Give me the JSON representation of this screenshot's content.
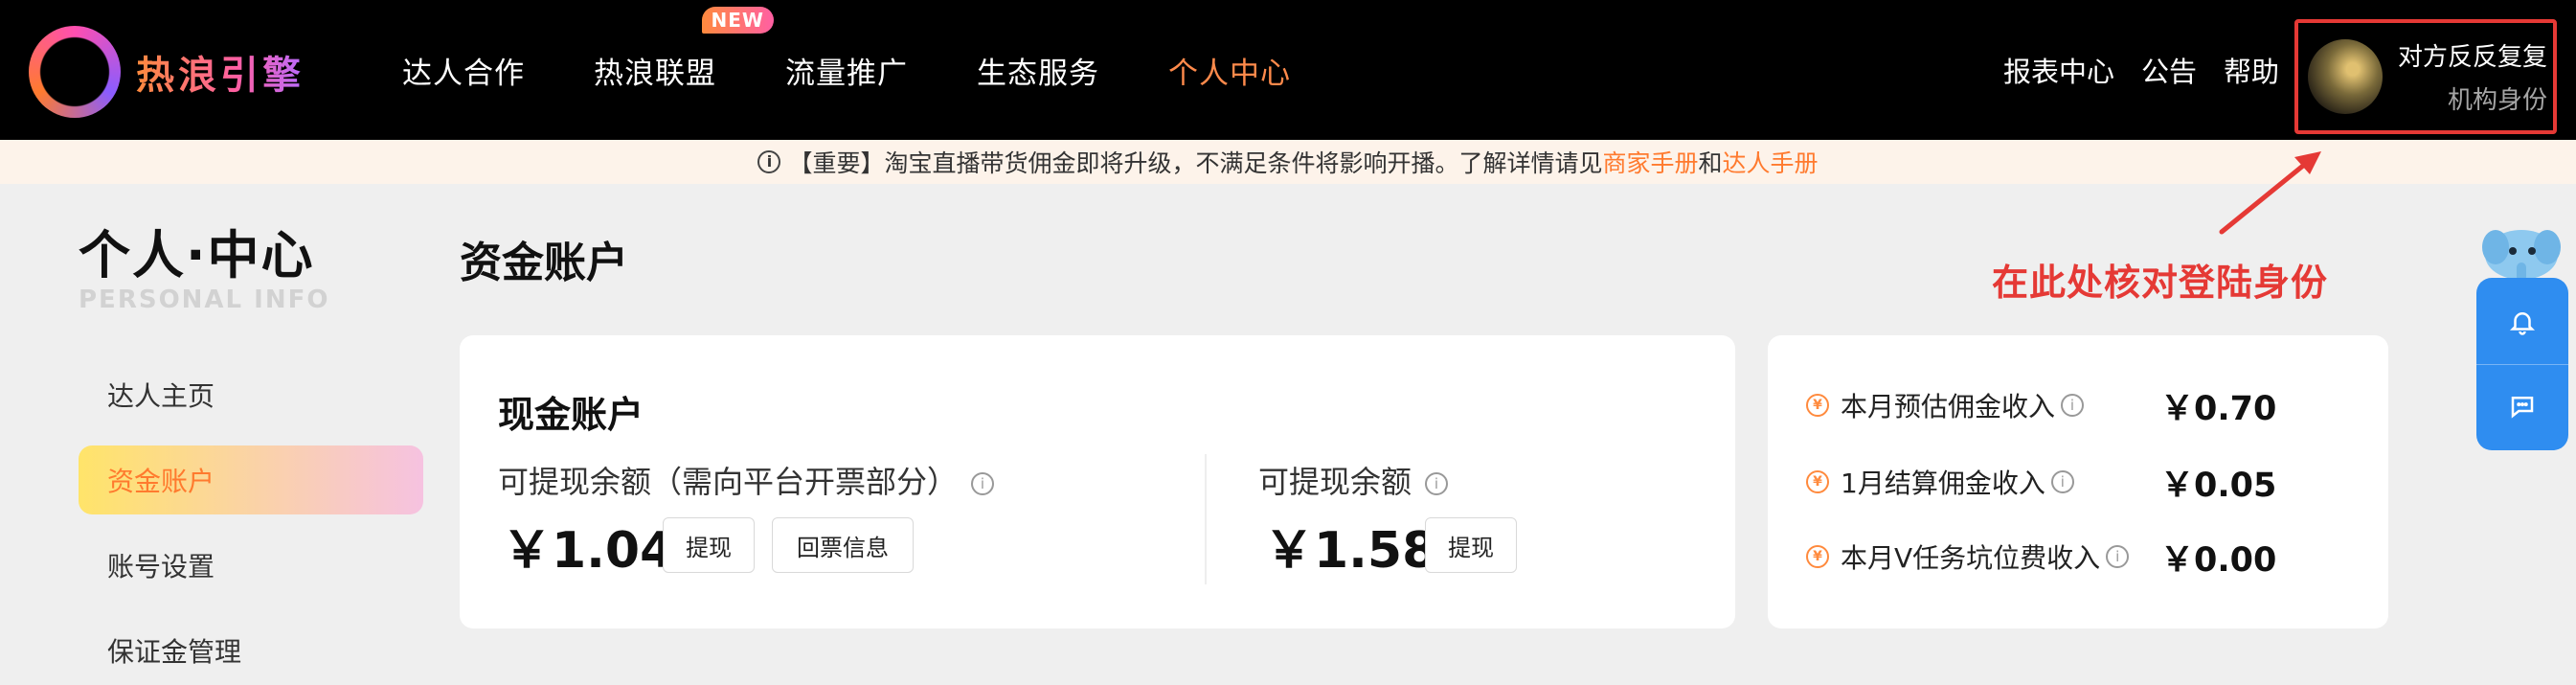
{
  "brand": {
    "name": "热浪引擎"
  },
  "nav": {
    "items": [
      "达人合作",
      "热浪联盟",
      "流量推广",
      "生态服务",
      "个人中心"
    ],
    "new_badge": "NEW",
    "active_index": 4
  },
  "header_right": {
    "report": "报表中心",
    "notice": "公告",
    "help": "帮助"
  },
  "user": {
    "name": "对方反反复复",
    "role": "机构身份"
  },
  "notice_bar": {
    "prefix": "【重要】淘宝直播带货佣金即将升级，不满足条件将影响开播。了解详情请见",
    "link1": "商家手册",
    "mid": "和",
    "link2": "达人手册"
  },
  "sidebar": {
    "title": "个人·中心",
    "subtitle": "PERSONAL INFO",
    "items": [
      "达人主页",
      "资金账户",
      "账号设置",
      "保证金管理"
    ],
    "active_index": 1
  },
  "main": {
    "page_title": "资金账户",
    "cash": {
      "title": "现金账户",
      "left_label": "可提现余额（需向平台开票部分）",
      "left_amount": "￥1.04",
      "withdraw": "提现",
      "invoice": "回票信息",
      "right_label": "可提现余额",
      "right_amount": "￥1.58"
    },
    "stats": [
      {
        "label": "本月预估佣金收入",
        "value": "￥0.70"
      },
      {
        "label": "1月结算佣金收入",
        "value": "￥0.05"
      },
      {
        "label": "本月V任务坑位费收入",
        "value": "￥0.00"
      }
    ]
  },
  "annotation": "在此处核对登陆身份",
  "colors": {
    "accent": "#ff7a2e",
    "annotation": "#e53935",
    "widget": "#2f8df0"
  },
  "icons": [
    "info-icon",
    "yen-icon",
    "bell-icon",
    "chat-icon",
    "arrow-annotation-icon"
  ]
}
